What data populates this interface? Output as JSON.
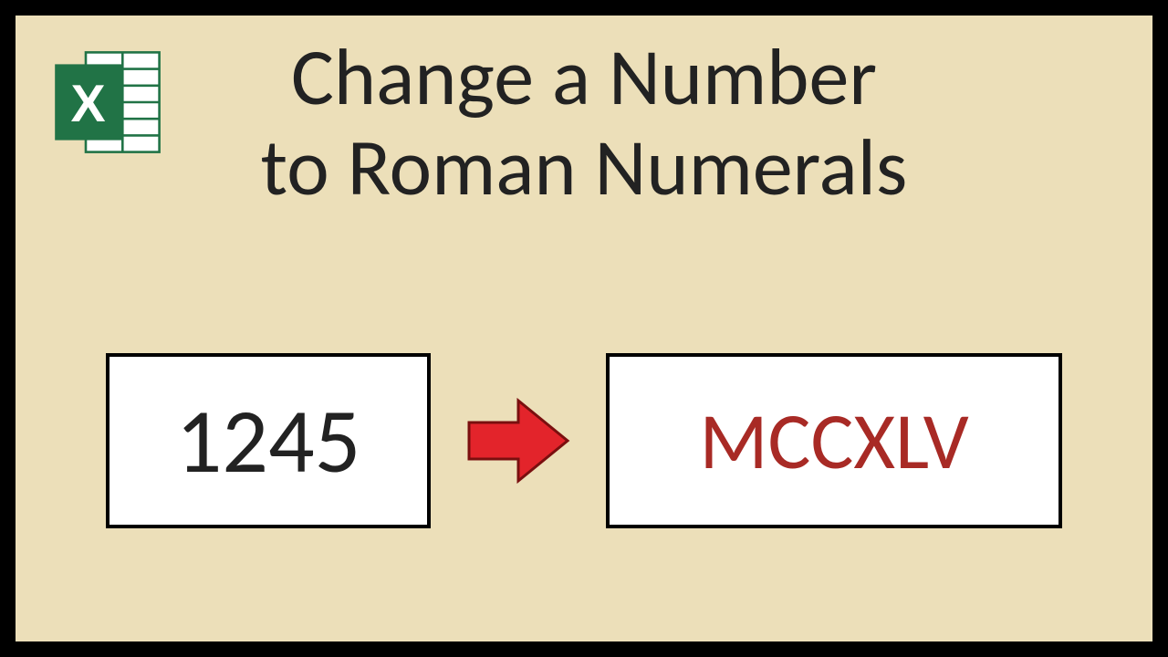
{
  "title_line1": "Change a Number",
  "title_line2": "to Roman Numerals",
  "conversion": {
    "input_number": "1245",
    "output_roman": "MCCXLV"
  },
  "colors": {
    "background": "#ecdfb9",
    "arrow_fill": "#e3242b",
    "arrow_stroke": "#7a0f0f",
    "roman_text": "#a82a25",
    "excel_green": "#217346"
  },
  "icons": {
    "excel": "excel-icon",
    "arrow": "arrow-right-icon"
  }
}
